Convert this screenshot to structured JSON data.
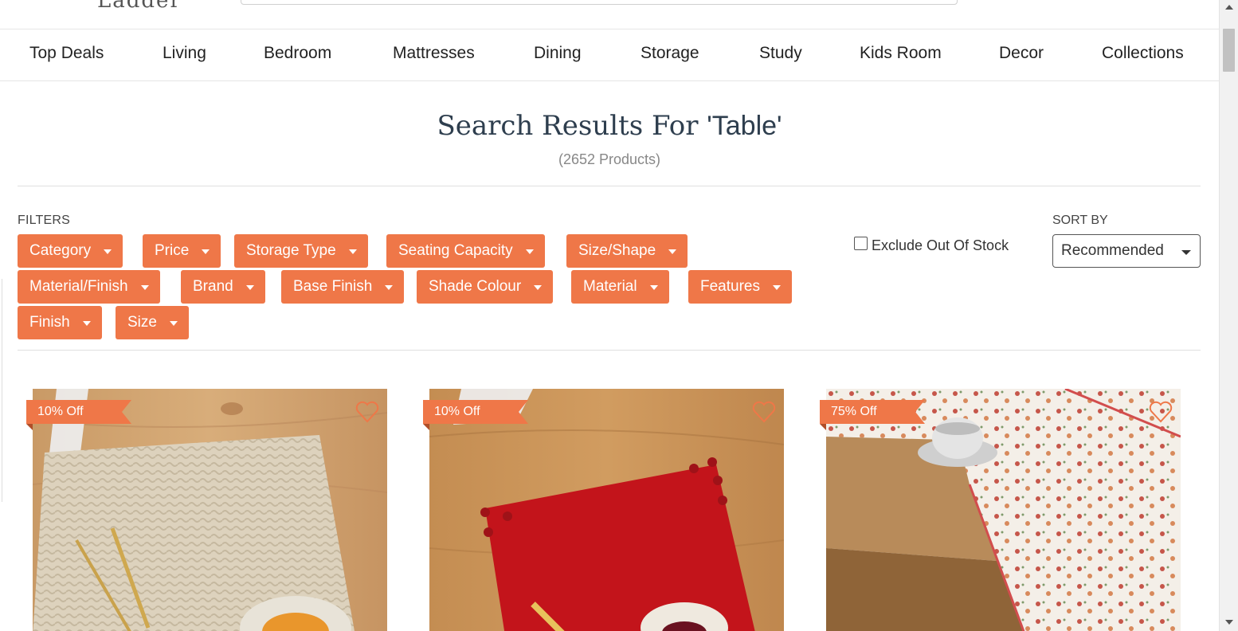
{
  "header": {
    "logo_text": "Ladder",
    "search_placeholder": ""
  },
  "nav": {
    "items": [
      {
        "label": "Top Deals"
      },
      {
        "label": "Living"
      },
      {
        "label": "Bedroom"
      },
      {
        "label": "Mattresses"
      },
      {
        "label": "Dining"
      },
      {
        "label": "Storage"
      },
      {
        "label": "Study"
      },
      {
        "label": "Kids Room"
      },
      {
        "label": "Decor"
      },
      {
        "label": "Collections"
      }
    ]
  },
  "results": {
    "title_prefix": "Search Results For ",
    "query": "'Table'",
    "count": "(2652 Products)"
  },
  "filters": {
    "label": "FILTERS",
    "chips": [
      {
        "label": "Category"
      },
      {
        "label": "Price"
      },
      {
        "label": "Storage Type"
      },
      {
        "label": "Seating Capacity"
      },
      {
        "label": "Size/Shape"
      },
      {
        "label": "Material/Finish"
      },
      {
        "label": "Brand"
      },
      {
        "label": "Base Finish"
      },
      {
        "label": "Shade Colour"
      },
      {
        "label": "Material"
      },
      {
        "label": "Features"
      },
      {
        "label": "Finish"
      },
      {
        "label": "Size"
      }
    ],
    "exclude_out_of_stock": {
      "label": "Exclude Out Of Stock",
      "checked": false
    }
  },
  "sort": {
    "label": "SORT BY",
    "selected": "Recommended"
  },
  "products": [
    {
      "badge": "10% Off",
      "image": "woven-placemat-beige-icon"
    },
    {
      "badge": "10% Off",
      "image": "red-placemat-pompom-icon"
    },
    {
      "badge": "75% Off",
      "image": "floral-table-runner-icon"
    }
  ],
  "colors": {
    "accent": "#ef7748",
    "title": "#2e3e4e"
  }
}
